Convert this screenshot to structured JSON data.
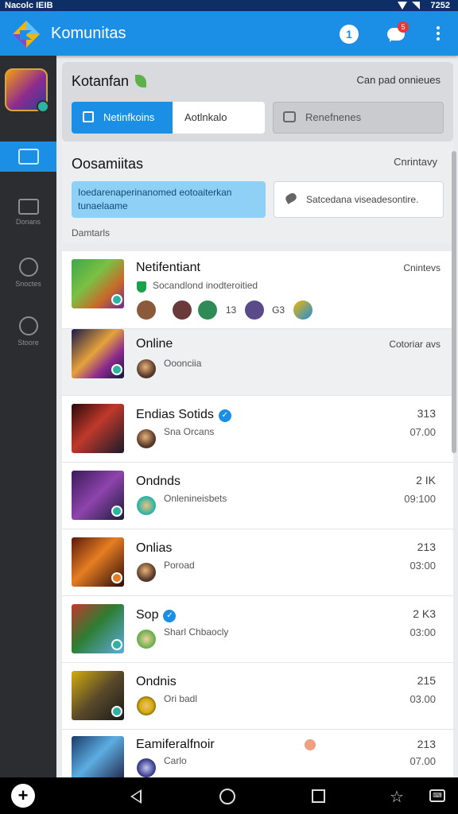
{
  "statusbar": {
    "left_text": "Nacolc IEIB",
    "time": "7252"
  },
  "app": {
    "title": "Komunitas",
    "info_label": "1",
    "chat_badge": "5"
  },
  "sidebar": {
    "items": [
      {
        "label": ""
      },
      {
        "label": "Donans"
      },
      {
        "label": "Snoctes"
      },
      {
        "label": "Stoore"
      }
    ]
  },
  "top_card": {
    "title": "Kotanfan",
    "link": "Can pad onnieues",
    "tab_active": "Netinfkoins",
    "tab_inactive": "Aotlnkalo",
    "tab_other": "Renefnenes"
  },
  "section": {
    "title": "Oosamiitas",
    "right_link": "Cnrintavy",
    "note_blue": "Ioedarenaperinanomed eotoaiterkan tunaelaame",
    "note_white": "Satcedana viseadesontire.",
    "sub_label": "Damtarls"
  },
  "featured": [
    {
      "name": "Netifentiant",
      "right": "Cnintevs",
      "sub": "Socandlond inodteroitied",
      "members": [
        "",
        "",
        "13",
        "G3"
      ]
    },
    {
      "name": "Online",
      "right": "Cotoriar avs",
      "sub": "Ooonciia"
    }
  ],
  "communities": [
    {
      "name": "Endias Sotids",
      "verified": true,
      "sub": "Sna Orcans",
      "count": "313",
      "time": "07.00"
    },
    {
      "name": "Ondnds",
      "verified": false,
      "sub": "Onlenineisbets",
      "count": "2 IK",
      "time": "09:100"
    },
    {
      "name": "Onlias",
      "verified": false,
      "sub": "Poroad",
      "count": "213",
      "time": "03:00"
    },
    {
      "name": "Sop",
      "verified": true,
      "sub": "Sharl Chbaocly",
      "count": "2 K3",
      "time": "03:00"
    },
    {
      "name": "Ondnis",
      "verified": false,
      "sub": "Ori badl",
      "count": "215",
      "time": "03.00"
    },
    {
      "name": "Eamiferalfnoir",
      "verified": false,
      "sub": "Carlo",
      "count": "213",
      "time": "07.00"
    }
  ],
  "colors": {
    "accent": "#1b8ee6",
    "sidebar": "#2b2d30",
    "badge": "#e53935",
    "online": "#2bb3a4"
  }
}
